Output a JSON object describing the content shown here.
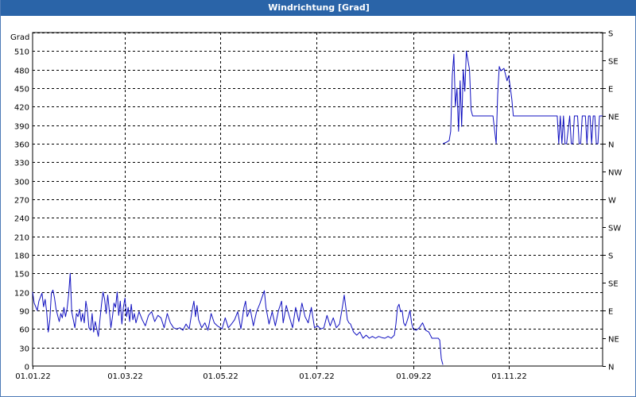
{
  "window": {
    "title": "Windrichtung [Grad]"
  },
  "chart_data": {
    "type": "line",
    "title": "Windrichtung [Grad]",
    "ylabel": "Grad",
    "xlabel": "",
    "ylim": [
      0,
      540
    ],
    "yticks": [
      0,
      30,
      60,
      90,
      120,
      150,
      180,
      210,
      240,
      270,
      300,
      330,
      360,
      390,
      420,
      450,
      480,
      510
    ],
    "right_axis_labels": [
      {
        "value": 0,
        "label": "N"
      },
      {
        "value": 45,
        "label": "NE"
      },
      {
        "value": 90,
        "label": "E"
      },
      {
        "value": 135,
        "label": "SE"
      },
      {
        "value": 180,
        "label": "S"
      },
      {
        "value": 225,
        "label": "SW"
      },
      {
        "value": 270,
        "label": "W"
      },
      {
        "value": 315,
        "label": "NW"
      },
      {
        "value": 360,
        "label": "N"
      },
      {
        "value": 405,
        "label": "NE"
      },
      {
        "value": 450,
        "label": "E"
      },
      {
        "value": 495,
        "label": "SE"
      },
      {
        "value": 540,
        "label": "S"
      }
    ],
    "x_start": "2022-01-01",
    "x_end": "2022-12-31",
    "xticks": [
      {
        "date": "2022-01-01",
        "label": "01.01.22"
      },
      {
        "date": "2022-03-01",
        "label": "01.03.22"
      },
      {
        "date": "2022-05-01",
        "label": "01.05.22"
      },
      {
        "date": "2022-07-01",
        "label": "01.07.22"
      },
      {
        "date": "2022-09-01",
        "label": "01.09.22"
      },
      {
        "date": "2022-11-01",
        "label": "01.11.22"
      }
    ],
    "grid": true,
    "colors": {
      "line": "#1010c0",
      "grid": "#000000",
      "titlebar": "#2a64a8"
    },
    "series": [
      {
        "points": [
          [
            "2022-01-01",
            120
          ],
          [
            "2022-01-02",
            102
          ],
          [
            "2022-01-04",
            90
          ],
          [
            "2022-01-05",
            105
          ],
          [
            "2022-01-07",
            118
          ],
          [
            "2022-01-08",
            96
          ],
          [
            "2022-01-09",
            108
          ],
          [
            "2022-01-10",
            88
          ],
          [
            "2022-01-11",
            55
          ],
          [
            "2022-01-12",
            75
          ],
          [
            "2022-01-13",
            118
          ],
          [
            "2022-01-14",
            123
          ],
          [
            "2022-01-15",
            110
          ],
          [
            "2022-01-16",
            92
          ],
          [
            "2022-01-17",
            82
          ],
          [
            "2022-01-18",
            72
          ],
          [
            "2022-01-19",
            85
          ],
          [
            "2022-01-20",
            78
          ],
          [
            "2022-01-21",
            95
          ],
          [
            "2022-01-22",
            80
          ],
          [
            "2022-01-23",
            92
          ],
          [
            "2022-01-24",
            115
          ],
          [
            "2022-01-25",
            150
          ],
          [
            "2022-01-26",
            88
          ],
          [
            "2022-01-27",
            75
          ],
          [
            "2022-01-28",
            62
          ],
          [
            "2022-01-29",
            85
          ],
          [
            "2022-01-30",
            80
          ],
          [
            "2022-01-31",
            92
          ],
          [
            "2022-02-01",
            72
          ],
          [
            "2022-02-02",
            85
          ],
          [
            "2022-02-03",
            70
          ],
          [
            "2022-02-04",
            105
          ],
          [
            "2022-02-05",
            90
          ],
          [
            "2022-02-06",
            62
          ],
          [
            "2022-02-07",
            58
          ],
          [
            "2022-02-08",
            85
          ],
          [
            "2022-02-09",
            55
          ],
          [
            "2022-02-10",
            72
          ],
          [
            "2022-02-11",
            60
          ],
          [
            "2022-02-12",
            48
          ],
          [
            "2022-02-13",
            75
          ],
          [
            "2022-02-14",
            100
          ],
          [
            "2022-02-15",
            120
          ],
          [
            "2022-02-16",
            108
          ],
          [
            "2022-02-17",
            85
          ],
          [
            "2022-02-18",
            115
          ],
          [
            "2022-02-19",
            90
          ],
          [
            "2022-02-20",
            62
          ],
          [
            "2022-02-21",
            80
          ],
          [
            "2022-02-22",
            102
          ],
          [
            "2022-02-23",
            95
          ],
          [
            "2022-02-24",
            120
          ],
          [
            "2022-02-25",
            82
          ],
          [
            "2022-02-26",
            105
          ],
          [
            "2022-02-27",
            68
          ],
          [
            "2022-02-28",
            95
          ],
          [
            "2022-03-01",
            110
          ],
          [
            "2022-03-02",
            80
          ],
          [
            "2022-03-03",
            95
          ],
          [
            "2022-03-04",
            72
          ],
          [
            "2022-03-05",
            100
          ],
          [
            "2022-03-06",
            75
          ],
          [
            "2022-03-07",
            85
          ],
          [
            "2022-03-08",
            70
          ],
          [
            "2022-03-10",
            88
          ],
          [
            "2022-03-12",
            75
          ],
          [
            "2022-03-14",
            65
          ],
          [
            "2022-03-16",
            82
          ],
          [
            "2022-03-18",
            88
          ],
          [
            "2022-03-20",
            72
          ],
          [
            "2022-03-22",
            82
          ],
          [
            "2022-03-24",
            78
          ],
          [
            "2022-03-26",
            62
          ],
          [
            "2022-03-28",
            85
          ],
          [
            "2022-03-30",
            70
          ],
          [
            "2022-04-01",
            62
          ],
          [
            "2022-04-03",
            60
          ],
          [
            "2022-04-05",
            62
          ],
          [
            "2022-04-07",
            58
          ],
          [
            "2022-04-09",
            68
          ],
          [
            "2022-04-11",
            60
          ],
          [
            "2022-04-13",
            92
          ],
          [
            "2022-04-14",
            105
          ],
          [
            "2022-04-15",
            80
          ],
          [
            "2022-04-16",
            98
          ],
          [
            "2022-04-17",
            75
          ],
          [
            "2022-04-19",
            62
          ],
          [
            "2022-04-21",
            70
          ],
          [
            "2022-04-23",
            58
          ],
          [
            "2022-04-25",
            85
          ],
          [
            "2022-04-27",
            70
          ],
          [
            "2022-04-29",
            65
          ],
          [
            "2022-05-01",
            62
          ],
          [
            "2022-05-02",
            60
          ],
          [
            "2022-05-04",
            78
          ],
          [
            "2022-05-06",
            62
          ],
          [
            "2022-05-08",
            68
          ],
          [
            "2022-05-10",
            75
          ],
          [
            "2022-05-12",
            88
          ],
          [
            "2022-05-14",
            60
          ],
          [
            "2022-05-16",
            95
          ],
          [
            "2022-05-17",
            105
          ],
          [
            "2022-05-18",
            80
          ],
          [
            "2022-05-20",
            92
          ],
          [
            "2022-05-22",
            65
          ],
          [
            "2022-05-24",
            88
          ],
          [
            "2022-05-26",
            100
          ],
          [
            "2022-05-28",
            115
          ],
          [
            "2022-05-29",
            122
          ],
          [
            "2022-05-30",
            95
          ],
          [
            "2022-06-01",
            68
          ],
          [
            "2022-06-03",
            88
          ],
          [
            "2022-06-05",
            65
          ],
          [
            "2022-06-07",
            90
          ],
          [
            "2022-06-09",
            105
          ],
          [
            "2022-06-10",
            70
          ],
          [
            "2022-06-12",
            98
          ],
          [
            "2022-06-14",
            80
          ],
          [
            "2022-06-16",
            62
          ],
          [
            "2022-06-18",
            95
          ],
          [
            "2022-06-20",
            72
          ],
          [
            "2022-06-22",
            102
          ],
          [
            "2022-06-24",
            80
          ],
          [
            "2022-06-26",
            70
          ],
          [
            "2022-06-28",
            95
          ],
          [
            "2022-06-30",
            62
          ],
          [
            "2022-07-02",
            65
          ],
          [
            "2022-07-04",
            60
          ],
          [
            "2022-07-06",
            62
          ],
          [
            "2022-07-08",
            82
          ],
          [
            "2022-07-10",
            65
          ],
          [
            "2022-07-12",
            78
          ],
          [
            "2022-07-14",
            62
          ],
          [
            "2022-07-16",
            68
          ],
          [
            "2022-07-18",
            98
          ],
          [
            "2022-07-19",
            115
          ],
          [
            "2022-07-20",
            95
          ],
          [
            "2022-07-21",
            75
          ],
          [
            "2022-07-22",
            70
          ],
          [
            "2022-07-23",
            68
          ],
          [
            "2022-07-25",
            55
          ],
          [
            "2022-07-27",
            50
          ],
          [
            "2022-07-29",
            55
          ],
          [
            "2022-07-31",
            45
          ],
          [
            "2022-08-02",
            50
          ],
          [
            "2022-08-04",
            45
          ],
          [
            "2022-08-06",
            48
          ],
          [
            "2022-08-08",
            45
          ],
          [
            "2022-08-10",
            48
          ],
          [
            "2022-08-12",
            46
          ],
          [
            "2022-08-14",
            45
          ],
          [
            "2022-08-16",
            48
          ],
          [
            "2022-08-18",
            45
          ],
          [
            "2022-08-20",
            50
          ],
          [
            "2022-08-21",
            68
          ],
          [
            "2022-08-22",
            95
          ],
          [
            "2022-08-23",
            100
          ],
          [
            "2022-08-24",
            88
          ],
          [
            "2022-08-25",
            90
          ],
          [
            "2022-08-26",
            70
          ],
          [
            "2022-08-27",
            65
          ],
          [
            "2022-08-28",
            72
          ],
          [
            "2022-08-29",
            80
          ],
          [
            "2022-08-30",
            90
          ],
          [
            "2022-08-31",
            70
          ],
          [
            "2022-09-01",
            60
          ],
          [
            "2022-09-03",
            58
          ],
          [
            "2022-09-05",
            62
          ],
          [
            "2022-09-07",
            70
          ],
          [
            "2022-09-09",
            58
          ],
          [
            "2022-09-11",
            55
          ],
          [
            "2022-09-13",
            45
          ],
          [
            "2022-09-15",
            45
          ],
          [
            "2022-09-17",
            45
          ],
          [
            "2022-09-18",
            42
          ],
          [
            "2022-09-19",
            12
          ],
          [
            "2022-09-20",
            2
          ]
        ]
      },
      {
        "points": [
          [
            "2022-09-20",
            360
          ],
          [
            "2022-09-22",
            362
          ],
          [
            "2022-09-24",
            365
          ],
          [
            "2022-09-25",
            380
          ],
          [
            "2022-09-26",
            470
          ],
          [
            "2022-09-27",
            505
          ],
          [
            "2022-09-28",
            420
          ],
          [
            "2022-09-29",
            450
          ],
          [
            "2022-09-30",
            380
          ],
          [
            "2022-10-01",
            462
          ],
          [
            "2022-10-02",
            388
          ],
          [
            "2022-10-03",
            480
          ],
          [
            "2022-10-04",
            445
          ],
          [
            "2022-10-05",
            510
          ],
          [
            "2022-10-06",
            495
          ],
          [
            "2022-10-07",
            480
          ],
          [
            "2022-10-08",
            415
          ],
          [
            "2022-10-09",
            405
          ],
          [
            "2022-10-13",
            405
          ],
          [
            "2022-10-17",
            405
          ],
          [
            "2022-10-22",
            405
          ],
          [
            "2022-10-24",
            360
          ],
          [
            "2022-10-25",
            440
          ],
          [
            "2022-10-26",
            485
          ],
          [
            "2022-10-27",
            478
          ],
          [
            "2022-10-29",
            482
          ],
          [
            "2022-10-31",
            462
          ],
          [
            "2022-11-01",
            470
          ],
          [
            "2022-11-02",
            452
          ],
          [
            "2022-11-03",
            432
          ],
          [
            "2022-11-04",
            405
          ],
          [
            "2022-11-10",
            405
          ],
          [
            "2022-11-18",
            405
          ],
          [
            "2022-11-26",
            405
          ],
          [
            "2022-12-02",
            405
          ],
          [
            "2022-12-03",
            360
          ],
          [
            "2022-12-04",
            405
          ],
          [
            "2022-12-05",
            360
          ],
          [
            "2022-12-06",
            405
          ],
          [
            "2022-12-07",
            360
          ],
          [
            "2022-12-08",
            360
          ],
          [
            "2022-12-10",
            405
          ],
          [
            "2022-12-11",
            360
          ],
          [
            "2022-12-12",
            360
          ],
          [
            "2022-12-13",
            405
          ],
          [
            "2022-12-15",
            405
          ],
          [
            "2022-12-16",
            360
          ],
          [
            "2022-12-17",
            360
          ],
          [
            "2022-12-18",
            405
          ],
          [
            "2022-12-20",
            405
          ],
          [
            "2022-12-21",
            360
          ],
          [
            "2022-12-22",
            405
          ],
          [
            "2022-12-23",
            405
          ],
          [
            "2022-12-24",
            360
          ],
          [
            "2022-12-25",
            405
          ],
          [
            "2022-12-26",
            405
          ],
          [
            "2022-12-27",
            360
          ],
          [
            "2022-12-28",
            360
          ],
          [
            "2022-12-29",
            405
          ],
          [
            "2022-12-31",
            405
          ]
        ]
      }
    ]
  }
}
